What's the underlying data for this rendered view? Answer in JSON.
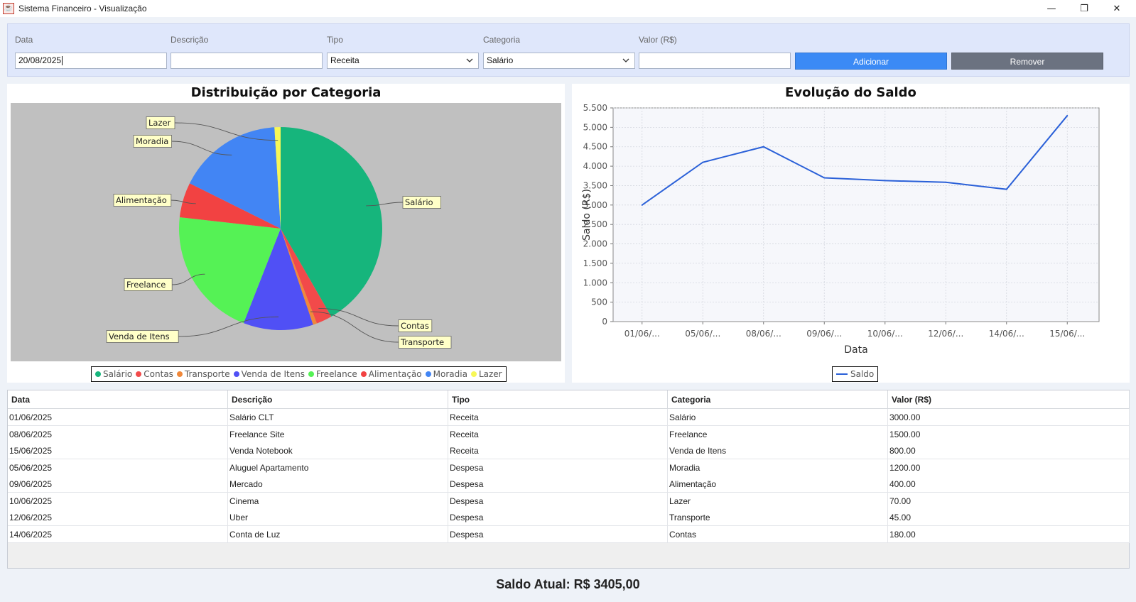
{
  "window": {
    "title": "Sistema Financeiro - Visualização",
    "minimize": "—",
    "restore": "❐",
    "close": "✕"
  },
  "form": {
    "labels": {
      "data": "Data",
      "descricao": "Descrição",
      "tipo": "Tipo",
      "categoria": "Categoria",
      "valor": "Valor (R$)"
    },
    "values": {
      "data": "20/08/2025",
      "descricao": "",
      "tipo": "Receita",
      "categoria": "Salário",
      "valor": ""
    },
    "buttons": {
      "add": "Adicionar",
      "remove": "Remover"
    },
    "colors": {
      "add": "#3b8af5",
      "remove": "#6b7280"
    }
  },
  "pie": {
    "title": "Distribuição por Categoria",
    "background": "#c0c0c0",
    "legend": [
      {
        "label": "Salário",
        "color": "#16b57c"
      },
      {
        "label": "Contas",
        "color": "#f24a4a"
      },
      {
        "label": "Transporte",
        "color": "#f0883a"
      },
      {
        "label": "Venda de Itens",
        "color": "#5050f5"
      },
      {
        "label": "Freelance",
        "color": "#55f255"
      },
      {
        "label": "Alimentação",
        "color": "#f24242"
      },
      {
        "label": "Moradia",
        "color": "#4285f4"
      },
      {
        "label": "Lazer",
        "color": "#f7f757"
      }
    ]
  },
  "line": {
    "title": "Evolução do Saldo",
    "xlabel": "Data",
    "ylabel": "Saldo (R$)",
    "legend": "Saldo",
    "yticks": [
      "0",
      "500",
      "1.000",
      "1.500",
      "2.000",
      "2.500",
      "3.000",
      "3.500",
      "4.000",
      "4.500",
      "5.000",
      "5.500"
    ],
    "xticks": [
      "01/06/...",
      "05/06/...",
      "08/06/...",
      "09/06/...",
      "10/06/...",
      "12/06/...",
      "14/06/...",
      "15/06/..."
    ]
  },
  "chart_data": [
    {
      "type": "pie",
      "title": "Distribuição por Categoria",
      "categories": [
        "Salário",
        "Contas",
        "Transporte",
        "Venda de Itens",
        "Freelance",
        "Alimentação",
        "Moradia",
        "Lazer"
      ],
      "values": [
        3000,
        180,
        45,
        800,
        1500,
        400,
        1200,
        70
      ],
      "legend": "bottom"
    },
    {
      "type": "line",
      "title": "Evolução do Saldo",
      "xlabel": "Data",
      "ylabel": "Saldo (R$)",
      "x": [
        "01/06/...",
        "05/06/...",
        "08/06/...",
        "09/06/...",
        "10/06/...",
        "12/06/...",
        "14/06/...",
        "15/06/..."
      ],
      "series": [
        {
          "name": "Saldo",
          "values": [
            3000,
            4100,
            4500,
            3700,
            3630,
            3585,
            3405,
            5300
          ]
        }
      ],
      "ylim": [
        0,
        5500
      ],
      "grid": true,
      "legend": "bottom"
    }
  ],
  "table": {
    "columns": [
      "Data",
      "Descrição",
      "Tipo",
      "Categoria",
      "Valor (R$)"
    ],
    "rows": [
      [
        "01/06/2025",
        "Salário CLT",
        "Receita",
        "Salário",
        "3000.00"
      ],
      [
        "08/06/2025",
        "Freelance Site",
        "Receita",
        "Freelance",
        "1500.00"
      ],
      [
        "15/06/2025",
        "Venda Notebook",
        "Receita",
        "Venda de Itens",
        "800.00"
      ],
      [
        "05/06/2025",
        "Aluguel Apartamento",
        "Despesa",
        "Moradia",
        "1200.00"
      ],
      [
        "09/06/2025",
        "Mercado",
        "Despesa",
        "Alimentação",
        "400.00"
      ],
      [
        "10/06/2025",
        "Cinema",
        "Despesa",
        "Lazer",
        "70.00"
      ],
      [
        "12/06/2025",
        "Uber",
        "Despesa",
        "Transporte",
        "45.00"
      ],
      [
        "14/06/2025",
        "Conta de Luz",
        "Despesa",
        "Contas",
        "180.00"
      ]
    ]
  },
  "footer": {
    "saldo": "Saldo Atual: R$ 3405,00"
  }
}
